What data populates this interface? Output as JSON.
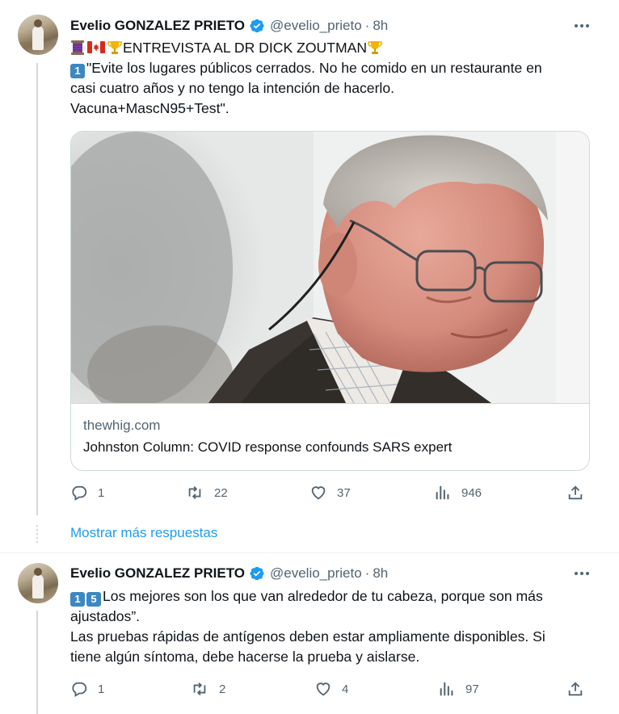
{
  "tweets": [
    {
      "author_name": "Evelio GONZALEZ PRIETO",
      "handle": "@evelio_prieto",
      "separator": "·",
      "time": "8h",
      "headline": "ENTREVISTA AL DR DICK ZOUTMAN",
      "number_badges": [
        "1"
      ],
      "lines": [
        "\"Evite los lugares públicos cerrados. No he comido en un restaurante en",
        "casi cuatro años y no tengo la intención de hacerlo.",
        "Vacuna+MascN95+Test\"."
      ],
      "card": {
        "domain": "thewhig.com",
        "title": "Johnston Column: COVID response confounds SARS expert"
      },
      "stats": {
        "replies": "1",
        "retweets": "22",
        "likes": "37",
        "views": "946"
      }
    },
    {
      "author_name": "Evelio GONZALEZ PRIETO",
      "handle": "@evelio_prieto",
      "separator": "·",
      "time": "8h",
      "number_badges": [
        "1",
        "5"
      ],
      "lines": [
        "Los mejores son los que van alrededor de tu cabeza, porque son más",
        "ajustados”.",
        "Las pruebas rápidas de antígenos deben estar ampliamente disponibles. Si",
        "tiene algún síntoma, debe hacerse la prueba y aislarse."
      ],
      "stats": {
        "replies": "1",
        "retweets": "2",
        "likes": "4",
        "views": "97"
      }
    }
  ],
  "show_more_label": "Mostrar más respuestas",
  "icons": {
    "more": "more-dots-icon",
    "verified": "verified-badge-icon",
    "reply": "reply-icon",
    "retweet": "retweet-icon",
    "like": "like-heart-icon",
    "views": "views-bar-chart-icon",
    "share": "share-icon"
  },
  "colors": {
    "accent": "#1d9bf0",
    "muted": "#536471",
    "text": "#0f1419",
    "border": "#cfd9de"
  }
}
